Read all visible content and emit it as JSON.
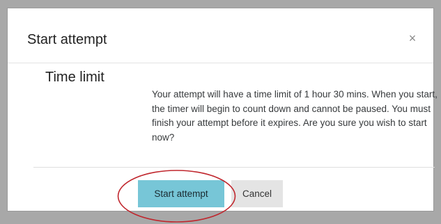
{
  "dialog": {
    "title": "Start attempt",
    "close_glyph": "×",
    "close_icon": "close-icon"
  },
  "section": {
    "heading": "Time limit",
    "message": "Your attempt will have a time limit of 1 hour 30 mins. When you start, the timer will begin to count down and cannot be paused. You must finish your attempt before it expires. Are you sure you wish to start now?"
  },
  "buttons": {
    "start_label": "Start attempt",
    "cancel_label": "Cancel"
  },
  "colors": {
    "primary_button": "#77c6d7",
    "secondary_button": "#e4e4e4",
    "annotation": "#c0262d"
  }
}
